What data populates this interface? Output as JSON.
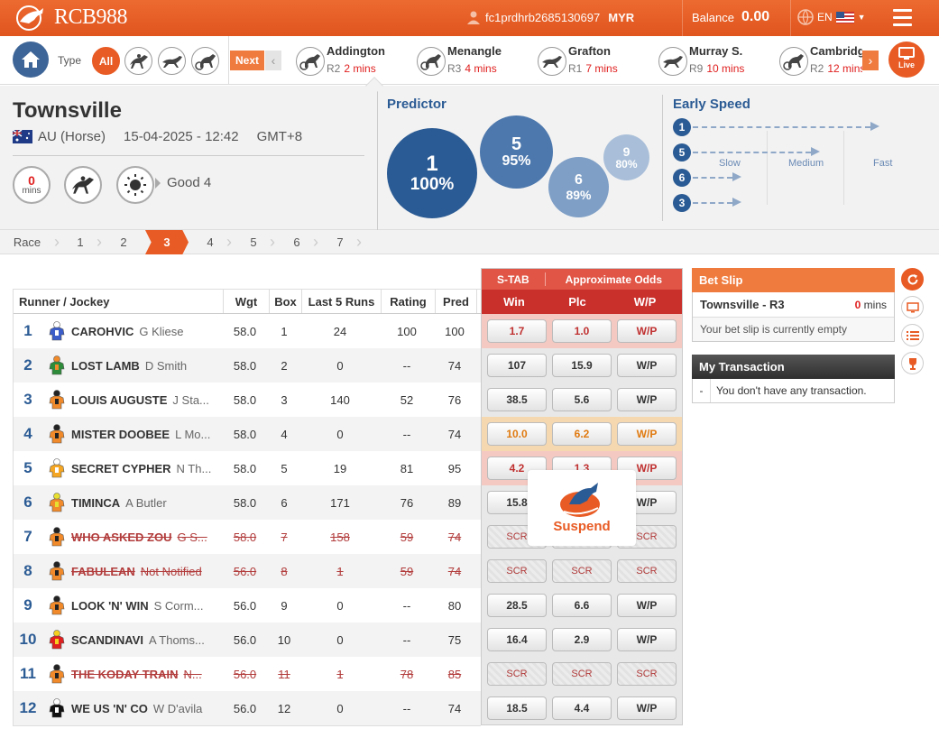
{
  "app": {
    "brand": "RCB988",
    "accent": "#e85b24",
    "navy": "#2b5b94"
  },
  "header": {
    "user_id": "fc1prdhrb2685130697",
    "currency": "MYR",
    "balance_label": "Balance",
    "balance": "0.00",
    "lang": "EN"
  },
  "nav": {
    "type_label": "Type",
    "all_label": "All",
    "next_label": "Next",
    "live_label": "Live",
    "races": [
      {
        "name": "Addington",
        "race": "R2",
        "mins": "2 mins",
        "icon": "harness-icon"
      },
      {
        "name": "Menangle",
        "race": "R3",
        "mins": "4 mins",
        "icon": "harness-icon"
      },
      {
        "name": "Grafton",
        "race": "R1",
        "mins": "7 mins",
        "icon": "greyhound-icon"
      },
      {
        "name": "Murray S.",
        "race": "R9",
        "mins": "10 mins",
        "icon": "greyhound-icon"
      },
      {
        "name": "Cambridg",
        "race": "R2",
        "mins": "12 mins",
        "icon": "harness-icon"
      }
    ]
  },
  "meeting": {
    "venue": "Townsville",
    "country": "AU (Horse)",
    "date": "15-04-2025 - 12:42",
    "tz": "GMT+8",
    "mins_value": "0",
    "mins_label": "mins",
    "going": "Good 4"
  },
  "predictor": {
    "title": "Predictor",
    "bubbles": [
      {
        "no": "1",
        "pct": "100%"
      },
      {
        "no": "5",
        "pct": "95%"
      },
      {
        "no": "6",
        "pct": "89%"
      },
      {
        "no": "9",
        "pct": "80%"
      }
    ]
  },
  "early_speed": {
    "title": "Early Speed",
    "labels": [
      "Slow",
      "Medium",
      "Fast"
    ],
    "runners": [
      {
        "no": "1",
        "level": 0.9
      },
      {
        "no": "5",
        "level": 0.6
      },
      {
        "no": "6",
        "level": 0.2
      },
      {
        "no": "3",
        "level": 0.2
      }
    ]
  },
  "race_tabs": {
    "label": "Race",
    "tabs": [
      "1",
      "2",
      "3",
      "4",
      "5",
      "6",
      "7"
    ],
    "active": "3"
  },
  "table": {
    "headers": {
      "runner": "Runner / Jockey",
      "wgt": "Wgt",
      "box": "Box",
      "last5": "Last 5 Runs",
      "rating": "Rating",
      "pred": "Pred"
    },
    "odds_group": {
      "stab": "S-TAB",
      "approx": "Approximate Odds",
      "win": "Win",
      "plc": "Plc",
      "wp": "W/P"
    },
    "runners": [
      {
        "no": "1",
        "name": "CAROHVIC",
        "jockey": "G Kliese",
        "wgt": "58.0",
        "box": "1",
        "last5": "24",
        "rating": "100",
        "pred": "100",
        "win": "1.7",
        "plc": "1.0",
        "wp": "W/P",
        "scr": false,
        "silk": [
          "#3b5dc9",
          "#ffffff"
        ]
      },
      {
        "no": "2",
        "name": "LOST LAMB",
        "jockey": "D Smith",
        "wgt": "58.0",
        "box": "2",
        "last5": "0",
        "rating": "--",
        "pred": "74",
        "win": "107",
        "plc": "15.9",
        "wp": "W/P",
        "scr": false,
        "silk": [
          "#2e8b3a",
          "#f08a2a"
        ]
      },
      {
        "no": "3",
        "name": "LOUIS AUGUSTE",
        "jockey": "J Sta...",
        "wgt": "58.0",
        "box": "3",
        "last5": "140",
        "rating": "52",
        "pred": "76",
        "win": "38.5",
        "plc": "5.6",
        "wp": "W/P",
        "scr": false,
        "silk": [
          "#f08a2a",
          "#222222"
        ]
      },
      {
        "no": "4",
        "name": "MISTER DOOBEE",
        "jockey": "L Mo...",
        "wgt": "58.0",
        "box": "4",
        "last5": "0",
        "rating": "--",
        "pred": "74",
        "win": "10.0",
        "plc": "6.2",
        "wp": "W/P",
        "scr": false,
        "silk": [
          "#f08a2a",
          "#222222"
        ]
      },
      {
        "no": "5",
        "name": "SECRET CYPHER",
        "jockey": "N Th...",
        "wgt": "58.0",
        "box": "5",
        "last5": "19",
        "rating": "81",
        "pred": "95",
        "win": "4.2",
        "plc": "1.3",
        "wp": "W/P",
        "scr": false,
        "silk": [
          "#f5a623",
          "#ffffff"
        ]
      },
      {
        "no": "6",
        "name": "TIMINCA",
        "jockey": "A Butler",
        "wgt": "58.0",
        "box": "6",
        "last5": "171",
        "rating": "76",
        "pred": "89",
        "win": "15.8",
        "plc": "",
        "wp": "W/P",
        "scr": false,
        "silk": [
          "#f08a2a",
          "#e8e030"
        ]
      },
      {
        "no": "7",
        "name": "WHO ASKED ZOU",
        "jockey": "G S...",
        "wgt": "58.0",
        "box": "7",
        "last5": "158",
        "rating": "59",
        "pred": "74",
        "win": "SCR",
        "plc": "",
        "wp": "SCR",
        "scr": true,
        "silk": [
          "#f08a2a",
          "#222222"
        ]
      },
      {
        "no": "8",
        "name": "FABULEAN",
        "jockey": "Not Notified",
        "wgt": "56.0",
        "box": "8",
        "last5": "1",
        "rating": "59",
        "pred": "74",
        "win": "SCR",
        "plc": "SCR",
        "wp": "SCR",
        "scr": true,
        "silk": [
          "#f08a2a",
          "#222222"
        ]
      },
      {
        "no": "9",
        "name": "LOOK 'N' WIN",
        "jockey": "S Corm...",
        "wgt": "56.0",
        "box": "9",
        "last5": "0",
        "rating": "--",
        "pred": "80",
        "win": "28.5",
        "plc": "6.6",
        "wp": "W/P",
        "scr": false,
        "silk": [
          "#f08a2a",
          "#222222"
        ]
      },
      {
        "no": "10",
        "name": "SCANDINAVI",
        "jockey": "A Thoms...",
        "wgt": "56.0",
        "box": "10",
        "last5": "0",
        "rating": "--",
        "pred": "75",
        "win": "16.4",
        "plc": "2.9",
        "wp": "W/P",
        "scr": false,
        "silk": [
          "#e02020",
          "#f5d020"
        ]
      },
      {
        "no": "11",
        "name": "THE KODAY TRAIN",
        "jockey": "N...",
        "wgt": "56.0",
        "box": "11",
        "last5": "1",
        "rating": "78",
        "pred": "85",
        "win": "SCR",
        "plc": "SCR",
        "wp": "SCR",
        "scr": true,
        "silk": [
          "#f08a2a",
          "#222222"
        ]
      },
      {
        "no": "12",
        "name": "WE US 'N' CO",
        "jockey": "W D'avila",
        "wgt": "56.0",
        "box": "12",
        "last5": "0",
        "rating": "--",
        "pred": "74",
        "win": "18.5",
        "plc": "4.4",
        "wp": "W/P",
        "scr": false,
        "silk": [
          "#111111",
          "#ffffff"
        ]
      }
    ]
  },
  "suspend": {
    "label": "Suspend"
  },
  "bet_slip": {
    "title": "Bet Slip",
    "race": "Townsville - R3",
    "mins_value": "0",
    "mins_label": "mins",
    "empty": "Your bet slip is currently empty"
  },
  "transaction": {
    "title": "My Transaction",
    "dash": "-",
    "empty": "You don't have any transaction."
  }
}
